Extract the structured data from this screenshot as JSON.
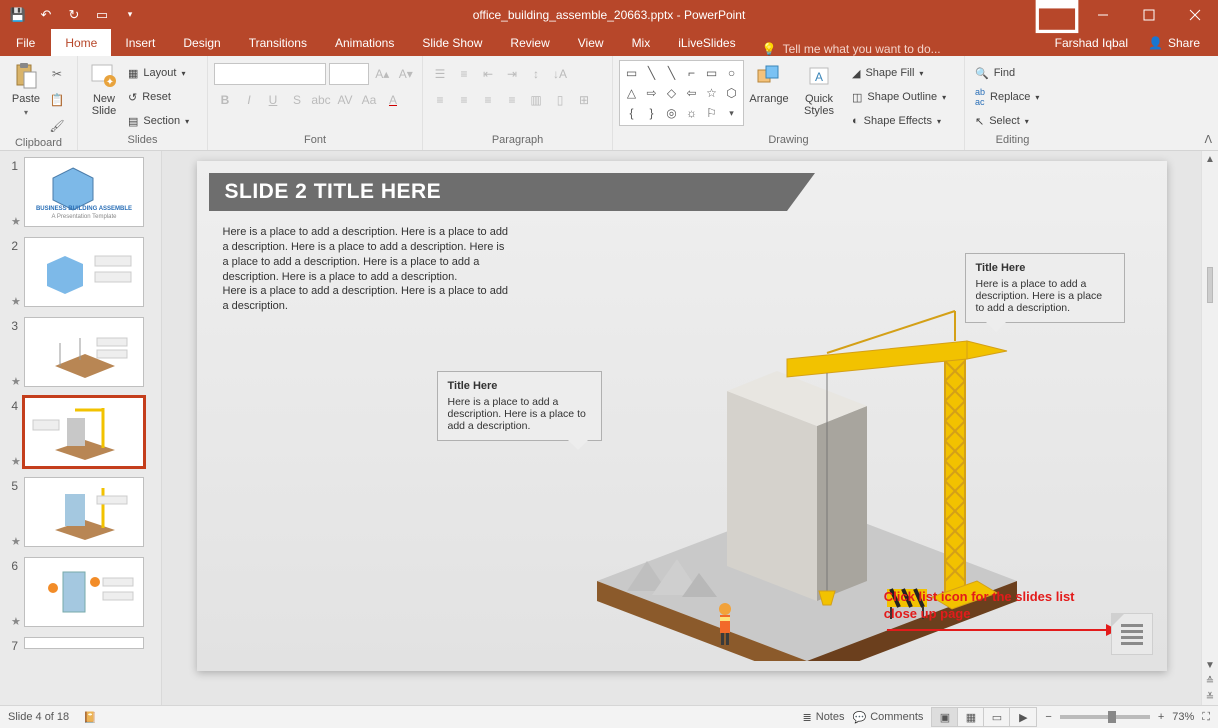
{
  "app": {
    "title": "office_building_assemble_20663.pptx - PowerPoint",
    "user": "Farshad Iqbal"
  },
  "tabs": {
    "file": "File",
    "home": "Home",
    "insert": "Insert",
    "design": "Design",
    "transitions": "Transitions",
    "animations": "Animations",
    "slideshow": "Slide Show",
    "review": "Review",
    "view": "View",
    "mix": "Mix",
    "iliveslides": "iLiveSlides",
    "tellme": "Tell me what you want to do...",
    "share": "Share"
  },
  "ribbon": {
    "clipboard": {
      "label": "Clipboard",
      "paste": "Paste"
    },
    "slides": {
      "label": "Slides",
      "newslide": "New\nSlide",
      "layout": "Layout",
      "reset": "Reset",
      "section": "Section"
    },
    "font": {
      "label": "Font"
    },
    "paragraph": {
      "label": "Paragraph"
    },
    "drawing": {
      "label": "Drawing",
      "arrange": "Arrange",
      "quick": "Quick\nStyles",
      "shapefill": "Shape Fill",
      "shapeoutline": "Shape Outline",
      "shapeeffects": "Shape Effects"
    },
    "editing": {
      "label": "Editing",
      "find": "Find",
      "replace": "Replace",
      "select": "Select"
    }
  },
  "slide": {
    "title": "SLIDE 2 TITLE HERE",
    "desc": "Here is a place to add a description. Here is a place to add a description. Here is a place to add a description. Here is a place to add a description. Here is a place to add a description. Here is a place to add a description.\nHere is a place to add a description. Here is a place to add a description.",
    "callout1_title": "Title Here",
    "callout1_body": "Here is a place to add a description. Here is a place to add a description.",
    "callout2_title": "Title Here",
    "callout2_body": "Here is a place to add a description. Here is a place to add a description.",
    "annotation": "Click list icon for the slides list\nclose up page"
  },
  "thumbs": {
    "numbers": [
      "1",
      "2",
      "3",
      "4",
      "5",
      "6",
      "7"
    ],
    "t1_line1": "BUSINESS BUILDING ASSEMBLE",
    "t1_line2": "A Presentation Template"
  },
  "status": {
    "slide_info": "Slide 4 of 18",
    "notes": "Notes",
    "comments": "Comments",
    "zoom": "73%"
  }
}
